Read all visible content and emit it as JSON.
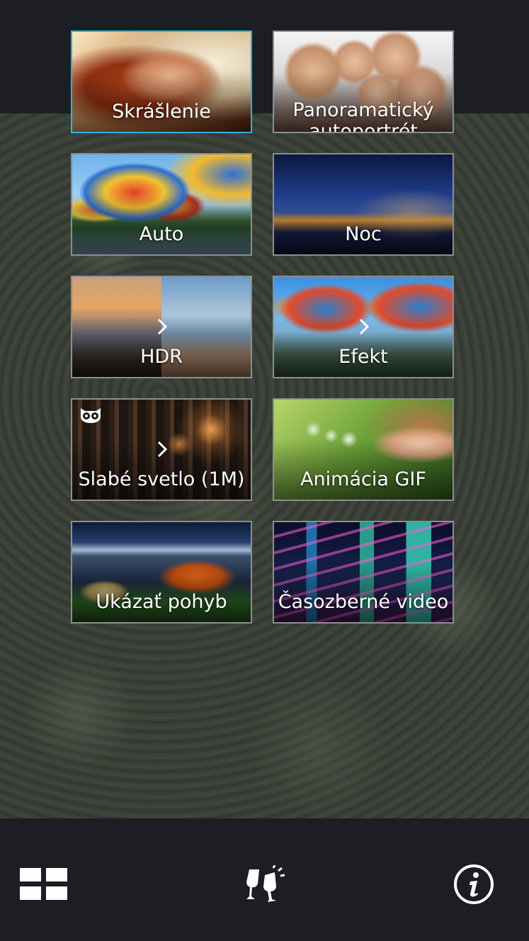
{
  "modes": [
    {
      "label": "Skrášlenie",
      "selected": true,
      "art": "beauty"
    },
    {
      "label": "Panoramatický autoportrét",
      "selected": false,
      "art": "pano"
    },
    {
      "label": "Auto",
      "selected": false,
      "art": "auto"
    },
    {
      "label": "Noc",
      "selected": false,
      "art": "night"
    },
    {
      "label": "HDR",
      "selected": false,
      "art": "hdr"
    },
    {
      "label": "Efekt",
      "selected": false,
      "art": "effect"
    },
    {
      "label": "Slabé svetlo (1M)",
      "selected": false,
      "art": "lowlight"
    },
    {
      "label": "Animácia GIF",
      "selected": false,
      "art": "gif"
    },
    {
      "label": "Ukázať pohyb",
      "selected": false,
      "art": "motion"
    },
    {
      "label": "Časozberné video",
      "selected": false,
      "art": "timelapse"
    }
  ],
  "bottom_bar": {
    "left_icon": "grid-view-icon",
    "center_icon": "toast-glasses-icon",
    "right_icon": "info-icon"
  },
  "colors": {
    "selected_border": "#29b6e0",
    "tile_border": "#8a8f90",
    "bar_background": "#1d1e23"
  }
}
